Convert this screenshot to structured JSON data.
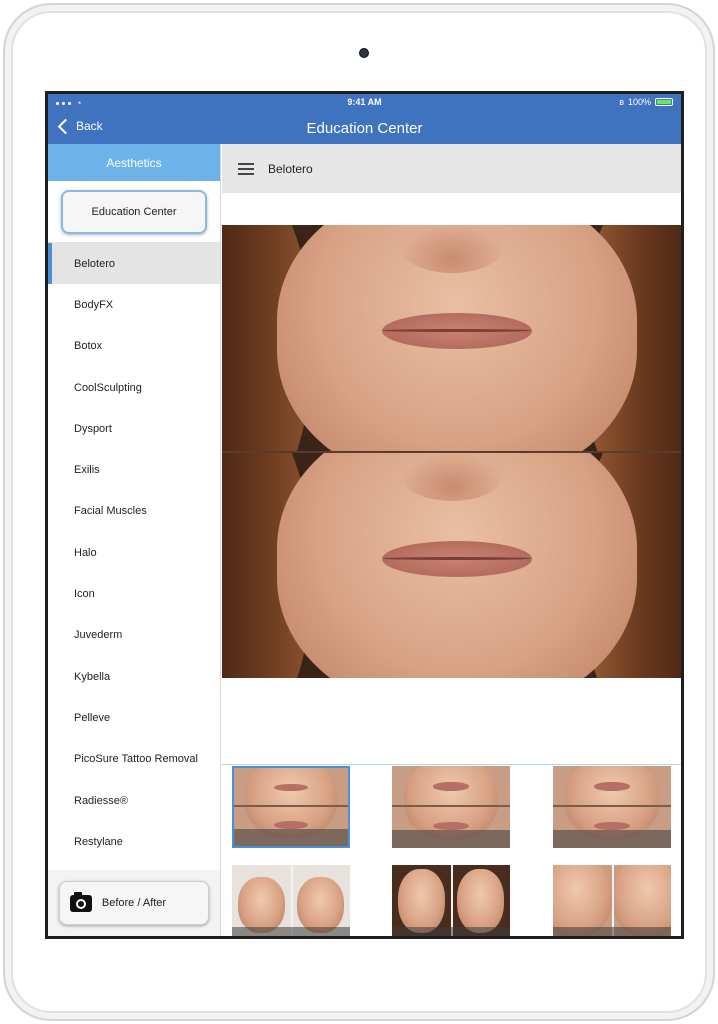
{
  "status_bar": {
    "time": "9:41 AM",
    "battery": "100%"
  },
  "nav": {
    "back_label": "Back",
    "title": "Education Center"
  },
  "sidebar": {
    "header": "Aesthetics",
    "top_button": "Education Center",
    "items": [
      {
        "label": "Belotero",
        "active": true
      },
      {
        "label": "BodyFX",
        "active": false
      },
      {
        "label": "Botox",
        "active": false
      },
      {
        "label": "CoolSculpting",
        "active": false
      },
      {
        "label": "Dysport",
        "active": false
      },
      {
        "label": "Exilis",
        "active": false
      },
      {
        "label": "Facial Muscles",
        "active": false
      },
      {
        "label": "Halo",
        "active": false
      },
      {
        "label": "Icon",
        "active": false
      },
      {
        "label": "Juvederm",
        "active": false
      },
      {
        "label": "Kybella",
        "active": false
      },
      {
        "label": "Pelleve",
        "active": false
      },
      {
        "label": "PicoSure Tattoo Removal",
        "active": false
      },
      {
        "label": "Radiesse®",
        "active": false
      },
      {
        "label": "Restylane",
        "active": false
      }
    ],
    "bottom_button": "Before / After",
    "bottom_button_icon": "camera-icon"
  },
  "content": {
    "menu_icon": "hamburger-icon",
    "title": "Belotero"
  },
  "colors": {
    "nav_blue": "#3f73c0",
    "sidebar_header": "#6db3ea",
    "selection": "#4a90d9"
  }
}
